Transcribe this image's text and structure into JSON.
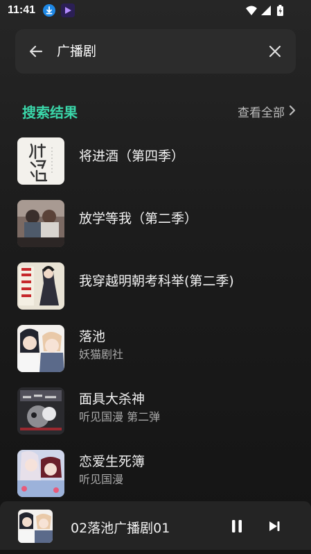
{
  "status_bar": {
    "time": "11:41",
    "icons": [
      "download-icon",
      "app-icon",
      "wifi-icon",
      "signal-icon",
      "battery-charging-icon"
    ]
  },
  "search": {
    "query": "广播剧",
    "back_icon": "arrow-left-icon",
    "clear_icon": "close-icon"
  },
  "section": {
    "title": "搜索结果",
    "view_all": "查看全部",
    "accent_color": "#3ad6a9"
  },
  "results": [
    {
      "title": "将进酒（第四季）",
      "subtitle": ""
    },
    {
      "title": "放学等我（第二季）",
      "subtitle": ""
    },
    {
      "title": "我穿越明朝考科举(第二季)",
      "subtitle": ""
    },
    {
      "title": "落池",
      "subtitle": "妖猫剧社"
    },
    {
      "title": "面具大杀神",
      "subtitle": "听见国漫 第二弹"
    },
    {
      "title": "恋爱生死簿",
      "subtitle": "听见国漫"
    }
  ],
  "player": {
    "title": "02落池广播剧01",
    "pause_icon": "pause-icon",
    "next_icon": "skip-next-icon"
  }
}
